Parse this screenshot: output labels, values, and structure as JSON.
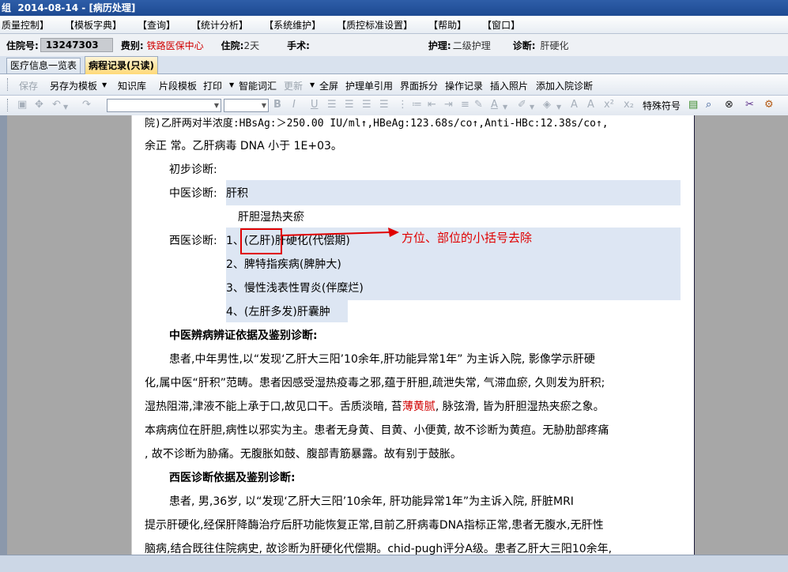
{
  "window": {
    "title": "组  2014-08-14 - [病历处理]"
  },
  "menu": [
    "质量控制】",
    "【模板字典】",
    "【查询】",
    "【统计分析】",
    "【系统维护】",
    "【质控标准设置】",
    "【帮助】",
    "【窗口】"
  ],
  "info": {
    "inpatient_no_label": "住院号:",
    "inpatient_no": "13247303",
    "payment_label": "费别:",
    "payment": "铁路医保中心",
    "stay_label": "住院:",
    "stay": "2天",
    "surgery_label": "手术:",
    "nursing_label": "护理:",
    "nursing": "二级护理",
    "diagnosis_label": "诊断:",
    "diagnosis": "肝硬化"
  },
  "tabs": [
    "医疗信息一览表",
    "病程记录(只读)"
  ],
  "toolbar": {
    "save": "保存",
    "save_as_template": "另存为模板",
    "knowledge": "知识库",
    "fragment": "片段模板",
    "print": "打印",
    "smart_words": "智能词汇",
    "update": "更新",
    "fullscreen": "全屏",
    "nursing_ref": "护理单引用",
    "split": "界面拆分",
    "op_record": "操作记录",
    "insert_photo": "插入照片",
    "add_diagnosis": "添加入院诊断"
  },
  "format_bar": {
    "special_symbol": "特殊符号"
  },
  "document": {
    "line1": "院)乙肝两对半浓度:HBsAg:＞250.00 IU/ml↑,HBeAg:123.68s/co↑,Anti-HBc:12.38s/co↑,",
    "line2": "余正 常。乙肝病毒 DNA 小于 1E+03。",
    "prelim_label": "初步诊断:",
    "tcm_label": "中医诊断:",
    "tcm_dx1": "肝积",
    "tcm_dx2": "肝胆湿热夹瘀",
    "wm_label": "西医诊断:",
    "wm_dx1_num": "1、",
    "wm_dx1_paren": "(乙肝)",
    "wm_dx1_rest": "肝硬化(代偿期)",
    "wm_dx2": "2、脾特指疾病(脾肿大)",
    "wm_dx3": "3、慢性浅表性胃炎(伴糜烂)",
    "wm_dx4": "4、(左肝多发)肝囊肿",
    "tcm_basis_title": "中医辨病辨证依据及鉴别诊断:",
    "p1_1": "患者,中年男性,以“发现‘乙肝大三阳’10余年,肝功能异常1年” 为主诉入院, 影像学示肝硬",
    "p1_2": "化,属中医“肝积”范畴。患者因感受湿热疫毒之邪,蕴于肝胆,疏泄失常, 气滞血瘀, 久则发为肝积;",
    "p1_3a": "湿热阻滞,津液不能上承于口,故见口干。舌质淡暗, 苔",
    "p1_3b": "薄黄腻",
    "p1_3c": ", 脉弦滑, 皆为肝胆湿热夹瘀之象。",
    "p1_4": "本病病位在肝胆,病性以邪实为主。患者无身黄、目黄、小便黄, 故不诊断为黄疸。无胁肋部疼痛",
    "p1_5": ", 故不诊断为胁痛。无腹胀如鼓、腹部青筋暴露。故有别于鼓胀。",
    "wm_basis_title": "西医诊断依据及鉴别诊断:",
    "p2_1": "患者, 男,36岁, 以“发现‘乙肝大三阳’10余年, 肝功能异常1年”为主诉入院, 肝脏MRI",
    "p2_2": "提示肝硬化,经保肝降酶治疗后肝功能恢复正常,目前乙肝病毒DNA指标正常,患者无腹水,无肝性",
    "p2_3": "脑病,结合既往住院病史, 故诊断为肝硬化代偿期。chid-pugh评分A级。患者乙肝大三阳10余年,"
  },
  "annotation": {
    "text": "方位、部位的小括号去除",
    "color": "#e00000"
  }
}
